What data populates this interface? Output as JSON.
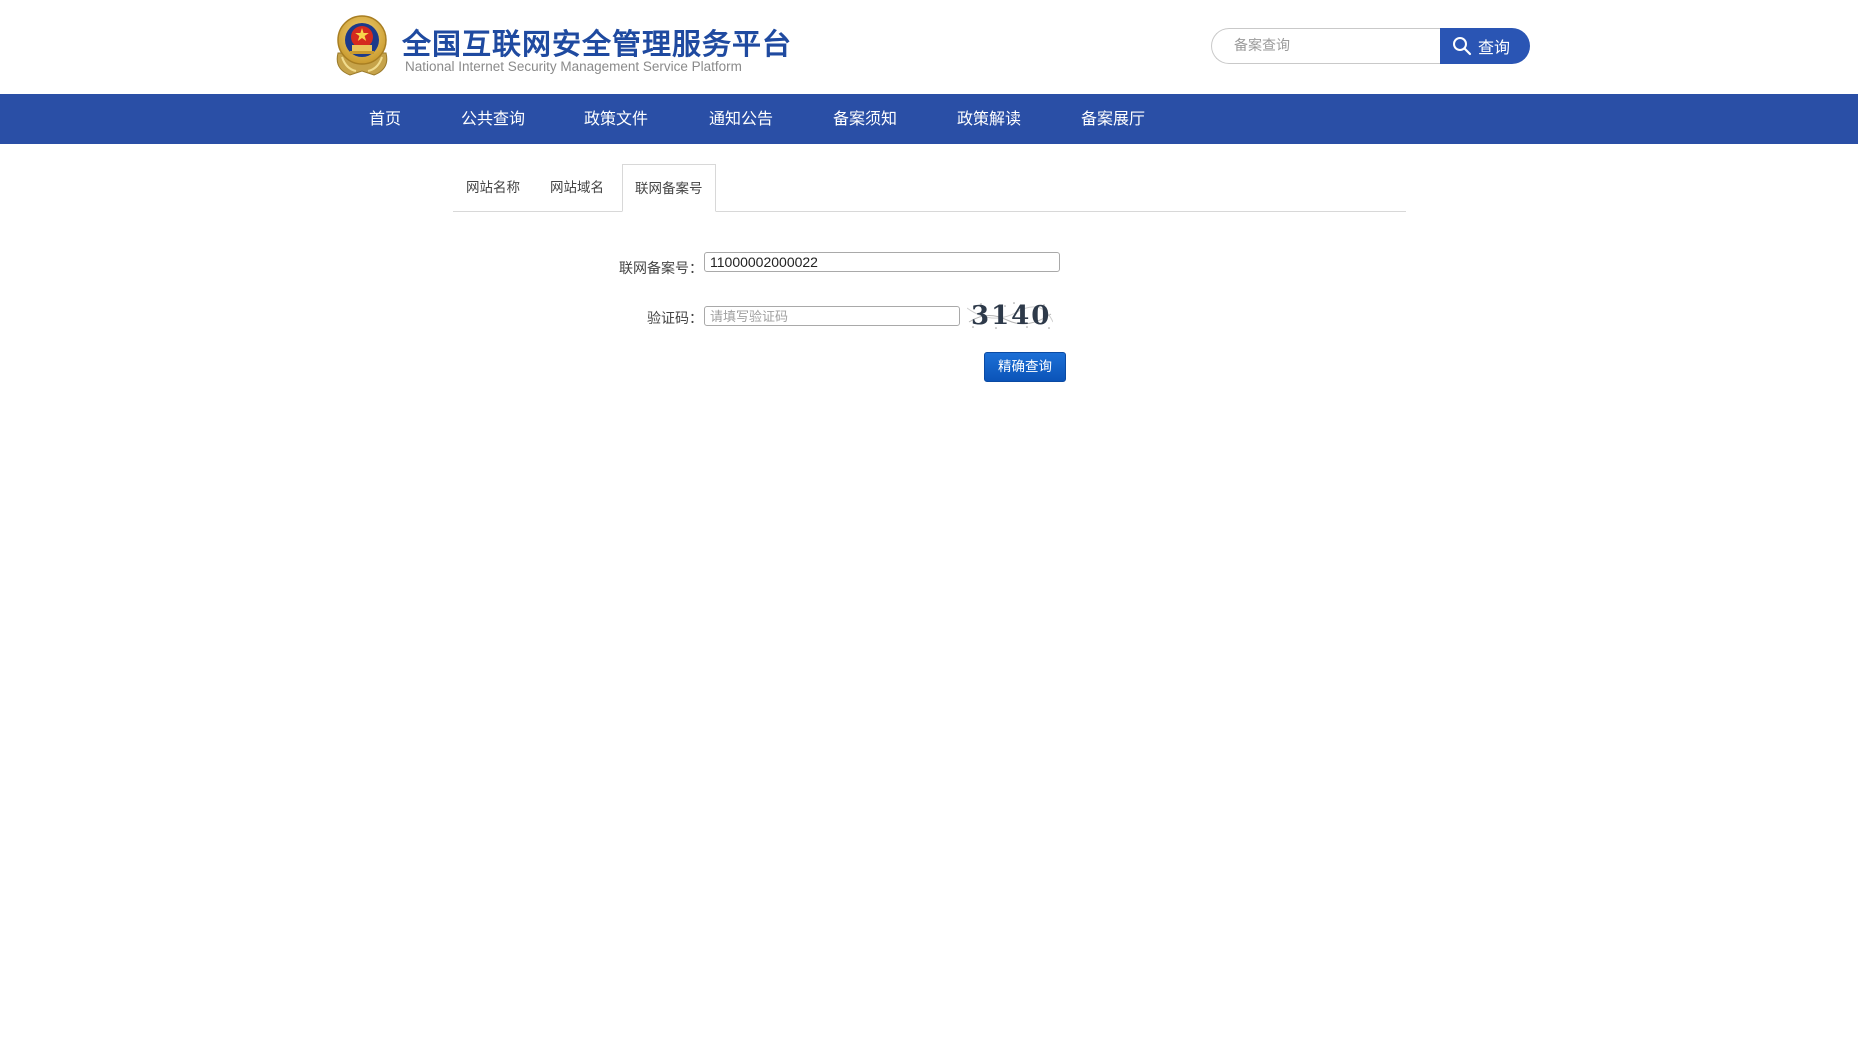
{
  "header": {
    "title": "全国互联网安全管理服务平台",
    "subtitle": "National Internet Security Management Service Platform",
    "search_placeholder": "备案查询",
    "search_button": "查询"
  },
  "nav": {
    "items": [
      "首页",
      "公共查询",
      "政策文件",
      "通知公告",
      "备案须知",
      "政策解读",
      "备案展厅"
    ]
  },
  "tabs": {
    "items": [
      "网站名称",
      "网站域名",
      "联网备案号"
    ],
    "active": "联网备案号"
  },
  "form": {
    "record_label": "联网备案号：",
    "record_value": "11000002000022",
    "captcha_label": "验证码：",
    "captcha_placeholder": "请填写验证码",
    "captcha_text": "3140",
    "submit_label": "精确查询"
  },
  "colors": {
    "brand_blue": "#2a4fa6",
    "title_blue": "#1f4aa0",
    "button_blue": "#1c6fd6"
  }
}
